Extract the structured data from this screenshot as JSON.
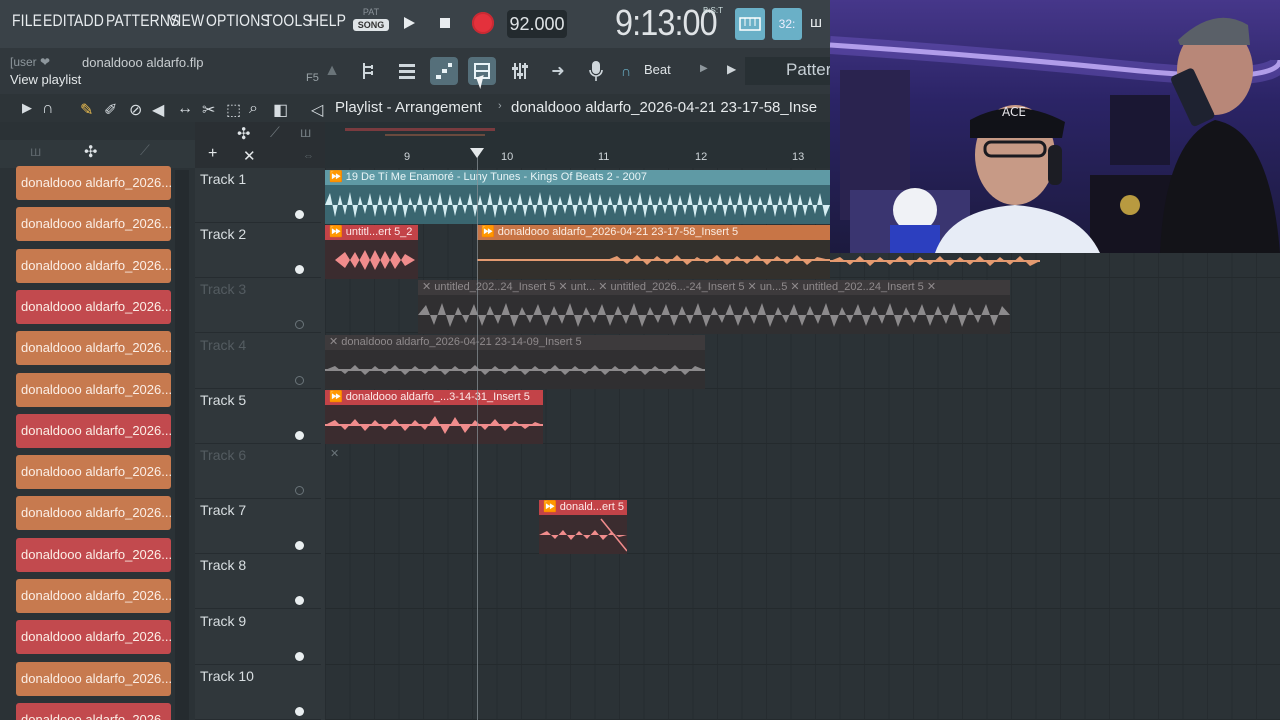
{
  "menu": [
    "FILE",
    "EDIT",
    "ADD",
    "PATTERNS",
    "VIEW",
    "OPTIONS",
    "TOOLS",
    "HELP"
  ],
  "transport": {
    "pat_label": "PAT",
    "song_label": "SONG",
    "tempo": "92.000",
    "time": "9:13:00",
    "time_suffix": "B:S:T",
    "tile2": "32:"
  },
  "hint": {
    "user": "[user ❤",
    "filename": "donaldooo aldarfo.flp",
    "line2": "View playlist",
    "shortcut": "F5"
  },
  "toolbar": {
    "beat_label": "Beat",
    "pattern_label": "Patterr"
  },
  "playlist": {
    "title": "Playlist - Arrangement",
    "arrow": "›",
    "name": "donaldooo aldarfo_2026-04-21 23-17-58_Inse"
  },
  "ruler": [
    "9",
    "10",
    "11",
    "12",
    "13"
  ],
  "picker_items": [
    {
      "label": "donaldooo aldarfo_2026...",
      "color": "orange"
    },
    {
      "label": "donaldooo aldarfo_2026...",
      "color": "orange"
    },
    {
      "label": "donaldooo aldarfo_2026...",
      "color": "orange"
    },
    {
      "label": "donaldooo aldarfo_2026...",
      "color": "red"
    },
    {
      "label": "donaldooo aldarfo_2026...",
      "color": "orange"
    },
    {
      "label": "donaldooo aldarfo_2026...",
      "color": "orange"
    },
    {
      "label": "donaldooo aldarfo_2026...",
      "color": "red"
    },
    {
      "label": "donaldooo aldarfo_2026...",
      "color": "orange"
    },
    {
      "label": "donaldooo aldarfo_2026...",
      "color": "orange"
    },
    {
      "label": "donaldooo aldarfo_2026...",
      "color": "red"
    },
    {
      "label": "donaldooo aldarfo_2026...",
      "color": "orange"
    },
    {
      "label": "donaldooo aldarfo_2026...",
      "color": "red"
    },
    {
      "label": "donaldooo aldarfo_2026...",
      "color": "orange"
    },
    {
      "label": "donaldooo aldarfo_2026...",
      "color": "red"
    }
  ],
  "tracks": [
    {
      "name": "Track 1",
      "muted": false
    },
    {
      "name": "Track 2",
      "muted": false
    },
    {
      "name": "Track 3",
      "muted": true
    },
    {
      "name": "Track 4",
      "muted": true
    },
    {
      "name": "Track 5",
      "muted": false
    },
    {
      "name": "Track 6",
      "muted": true
    },
    {
      "name": "Track 7",
      "muted": false
    },
    {
      "name": "Track 8",
      "muted": false
    },
    {
      "name": "Track 9",
      "muted": false
    },
    {
      "name": "Track 10",
      "muted": false
    }
  ],
  "clips": {
    "t1": "19 De Tí Me Enamoré - Luny Tunes - Kings Of Beats 2 - 2007",
    "t2a": "untitl...ert 5_2",
    "t2b": "donaldooo aldarfo_2026-04-21 23-17-58_Insert 5",
    "t3a": "untitled_202..24_Insert 5",
    "t3b": "unt...",
    "t3c": "untitled_2026...-24_Insert 5",
    "t3d": "un...5",
    "t3e": "untitled_202..24_Insert 5",
    "t4": "donaldooo aldarfo_2026-04-21 23-14-09_Insert 5",
    "t5": "donaldooo aldarfo_...3-14-31_Insert 5",
    "t7": "donald...ert 5"
  },
  "colors": {
    "accent": "#6ab0c7",
    "record": "#e4313c",
    "clip_orange": "#c77a4f",
    "clip_red": "#c24a4e",
    "clip_teal": "#5f9aa5"
  }
}
